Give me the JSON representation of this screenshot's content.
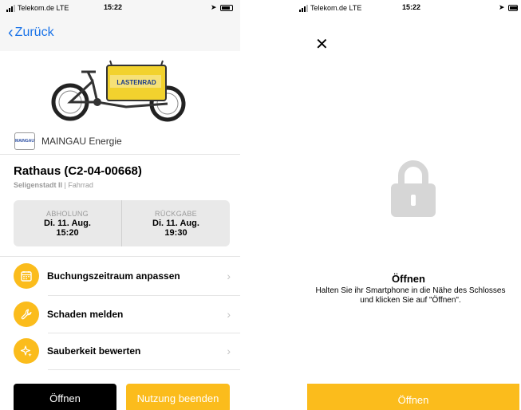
{
  "left": {
    "status": {
      "carrier": "Telekom.de",
      "network": "LTE",
      "time": "15:22"
    },
    "back_label": "Zurück",
    "provider": {
      "logo_text": "MAINGAU",
      "name": "MAINGAU Energie"
    },
    "bike_box_text": "LASTENRAD",
    "title": "Rathaus (C2-04-00668)",
    "location": "Seligenstadt II",
    "separator": " | ",
    "vehicle_type": "Fahrrad",
    "pickup": {
      "label": "ABHOLUNG",
      "date": "Di. 11. Aug.",
      "time": "15:20"
    },
    "return": {
      "label": "RÜCKGABE",
      "date": "Di. 11. Aug.",
      "time": "19:30"
    },
    "actions": [
      {
        "label": "Buchungszeitraum anpassen",
        "icon": "calendar-icon"
      },
      {
        "label": "Schaden melden",
        "icon": "wrench-icon"
      },
      {
        "label": "Sauberkeit bewerten",
        "icon": "sparkle-icon"
      }
    ],
    "open_button": "Öffnen",
    "end_button": "Nutzung beenden"
  },
  "right": {
    "status": {
      "carrier": "Telekom.de",
      "network": "LTE",
      "time": "15:22"
    },
    "title": "Öffnen",
    "description": "Halten Sie ihr Smartphone in die Nähe des Schlosses und klicken Sie auf \"Öffnen\".",
    "open_button": "Öffnen"
  },
  "colors": {
    "accent": "#fbbc1c",
    "link": "#1a73e8",
    "lock_gray": "#d6d6d6"
  }
}
